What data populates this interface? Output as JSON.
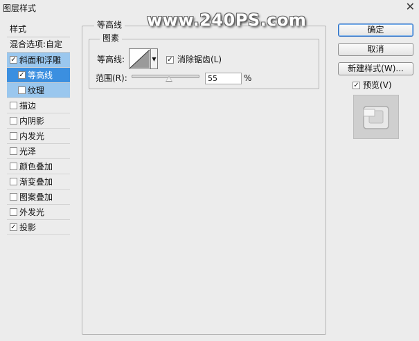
{
  "window": {
    "title": "图层样式",
    "watermark": "www.240PS.com"
  },
  "stylelist": {
    "header": "样式",
    "blending": "混合选项:自定",
    "items": [
      {
        "label": "斜面和浮雕",
        "checked": true
      },
      {
        "label": "等高线",
        "checked": true
      },
      {
        "label": "纹理",
        "checked": false
      },
      {
        "label": "描边",
        "checked": false
      },
      {
        "label": "内阴影",
        "checked": false
      },
      {
        "label": "内发光",
        "checked": false
      },
      {
        "label": "光泽",
        "checked": false
      },
      {
        "label": "颜色叠加",
        "checked": false
      },
      {
        "label": "渐变叠加",
        "checked": false
      },
      {
        "label": "图案叠加",
        "checked": false
      },
      {
        "label": "外发光",
        "checked": false
      },
      {
        "label": "投影",
        "checked": true
      }
    ]
  },
  "panel": {
    "section_title": "等高线",
    "group_title": "图素",
    "contour_label": "等高线:",
    "antialias_label": "消除锯齿(L)",
    "antialias_checked": true,
    "range_label": "范围(R):",
    "range_value": "55",
    "range_unit": "%",
    "range_fraction": 0.55
  },
  "buttons": {
    "ok": "确定",
    "cancel": "取消",
    "new_style": "新建样式(W)...",
    "preview_label": "预览(V)",
    "preview_checked": true
  },
  "colors": {
    "selected_row": "#9ac7ee",
    "active_row": "#3b8fe0"
  }
}
